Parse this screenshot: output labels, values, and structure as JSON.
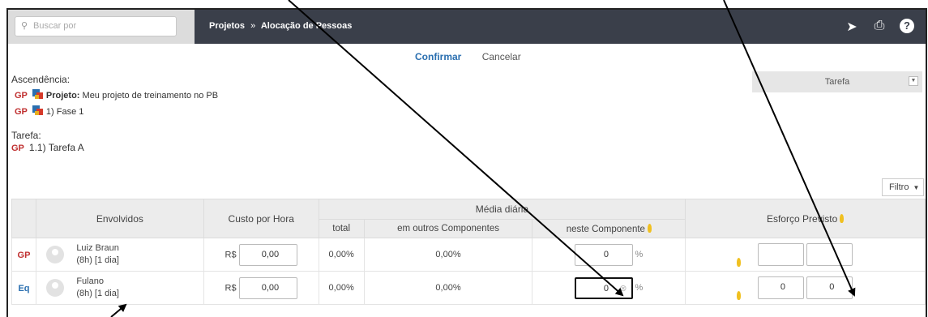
{
  "topbar": {
    "search_placeholder": "Buscar por",
    "breadcrumb": [
      "Projetos",
      "Alocação de Pessoas"
    ],
    "breadcrumb_separator": "»",
    "icons": [
      "send-icon",
      "print-icon",
      "help-icon"
    ]
  },
  "actions": {
    "confirm": "Confirmar",
    "cancel": "Cancelar"
  },
  "tarefa_select": {
    "value": "Tarefa"
  },
  "ascendencia": {
    "label": "Ascendência:",
    "items": [
      {
        "badge": "GP",
        "bold": "Projeto:",
        "text": "Meu projeto de treinamento no PB"
      },
      {
        "badge": "GP",
        "text": "1) Fase 1"
      }
    ]
  },
  "tarefa": {
    "label": "Tarefa:",
    "badge": "GP",
    "text": "1.1) Tarefa A"
  },
  "filtro": {
    "label": "Filtro"
  },
  "table": {
    "headers": {
      "envolvidos": "Envolvidos",
      "custo": "Custo por Hora",
      "media": "Média diária",
      "total": "total",
      "outros": "em outros Componentes",
      "neste": "neste Componente",
      "esforco": "Esforço Previsto"
    },
    "rows": [
      {
        "badge": "GP",
        "name": "Luiz Braun",
        "detail": "(8h) [1 dia]",
        "currency": "R$",
        "cost": "0,00",
        "total": "0,00%",
        "outros": "0,00%",
        "neste": "0",
        "pct": "%",
        "esf1": "",
        "esf2": ""
      },
      {
        "badge": "Eq",
        "name": "Fulano",
        "detail": "(8h) [1 dia]",
        "currency": "R$",
        "cost": "0,00",
        "total": "0,00%",
        "outros": "0,00%",
        "neste": "0",
        "pct": "%",
        "esf1": "0",
        "esf2": "0"
      }
    ]
  },
  "colors": {
    "topbar": "#3a3f4a",
    "gp_badge": "#c03030",
    "eq_badge": "#2a6fb0",
    "confirm": "#2a6fb0"
  }
}
